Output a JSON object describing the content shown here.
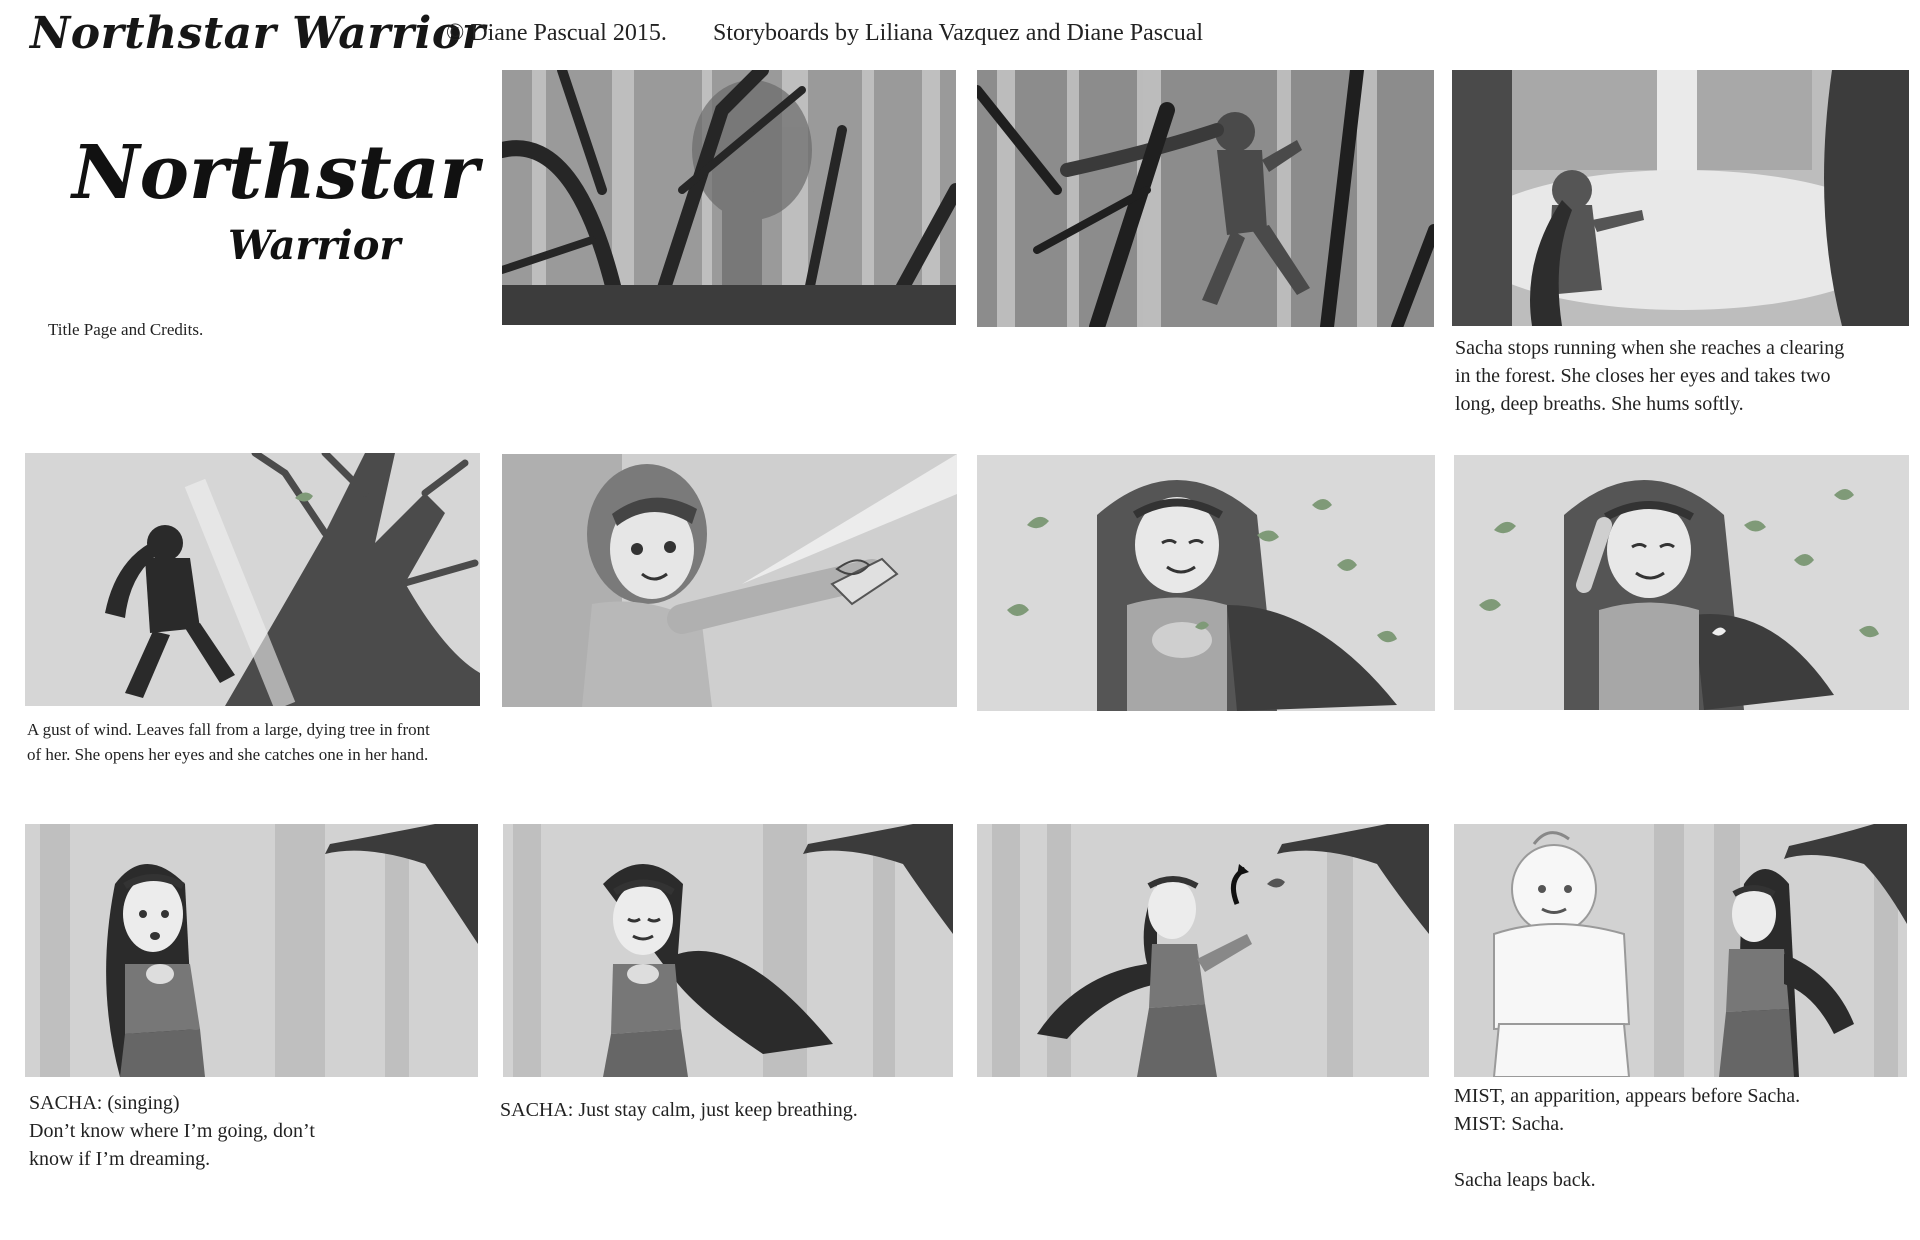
{
  "header": {
    "logo_text": "Northstar Warrior",
    "copyright": "© Diane Pascual 2015.",
    "byline": "Storyboards by Liliana Vazquez and Diane Pascual"
  },
  "title_block": {
    "title_main": "Northstar",
    "title_sub": "Warrior",
    "note": "Title Page and Credits."
  },
  "captions": {
    "row1_panel3": "Sacha stops running when she reaches a clearing\nin the forest. She closes her eyes and takes two\nlong, deep breaths. She hums softly.",
    "row2_panel1": "A gust of wind. Leaves fall from a large, dying tree in front\nof her. She opens her eyes and she catches one in her hand.",
    "row3_panel1": "SACHA:  (singing)\nDon’t know where I’m going, don’t\nknow if I’m dreaming.",
    "row3_panel2": "SACHA: Just stay calm, just keep breathing.",
    "row3_panel4": "MIST, an apparition, appears before Sacha.\nMIST:  Sacha.\n\nSacha leaps back."
  },
  "colors": {
    "panel_dark": "#3a3a3a",
    "panel_mid": "#8a8a8a",
    "panel_light": "#d9d9d9",
    "leaf_green": "#7f9a78",
    "figure": "#2b2b2b"
  }
}
